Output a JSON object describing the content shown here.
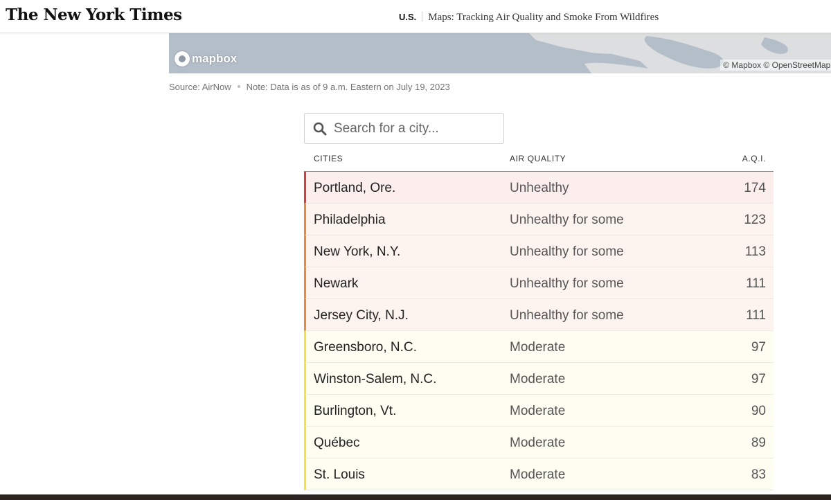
{
  "header": {
    "logo": "The New York Times",
    "section": "U.S.",
    "article_title": "Maps: Tracking Air Quality and Smoke From Wildfires"
  },
  "map": {
    "logo_text": "mapbox",
    "attribution": "© Mapbox © OpenStreetMap  I"
  },
  "source_line": {
    "source": "Source: AirNow",
    "note": "Note: Data is as of 9 a.m. Eastern on July 19, 2023"
  },
  "search": {
    "placeholder": "Search for a city...",
    "value": ""
  },
  "table": {
    "headers": {
      "city": "CITIES",
      "air_quality": "AIR QUALITY",
      "aqi": "A.Q.I."
    },
    "rows": [
      {
        "city": "Portland, Ore.",
        "air_quality": "Unhealthy",
        "aqi": "174"
      },
      {
        "city": "Philadelphia",
        "air_quality": "Unhealthy for some",
        "aqi": "123"
      },
      {
        "city": "New York, N.Y.",
        "air_quality": "Unhealthy for some",
        "aqi": "113"
      },
      {
        "city": "Newark",
        "air_quality": "Unhealthy for some",
        "aqi": "111"
      },
      {
        "city": "Jersey City, N.J.",
        "air_quality": "Unhealthy for some",
        "aqi": "111"
      },
      {
        "city": "Greensboro, N.C.",
        "air_quality": "Moderate",
        "aqi": "97"
      },
      {
        "city": "Winston-Salem, N.C.",
        "air_quality": "Moderate",
        "aqi": "97"
      },
      {
        "city": "Burlington, Vt.",
        "air_quality": "Moderate",
        "aqi": "90"
      },
      {
        "city": "Québec",
        "air_quality": "Moderate",
        "aqi": "89"
      },
      {
        "city": "St. Louis",
        "air_quality": "Moderate",
        "aqi": "83"
      }
    ]
  },
  "colors": {
    "unhealthy": "#d73c3c",
    "unhealthy_for_some": "#ec8a3c",
    "moderate": "#f2e23a"
  }
}
